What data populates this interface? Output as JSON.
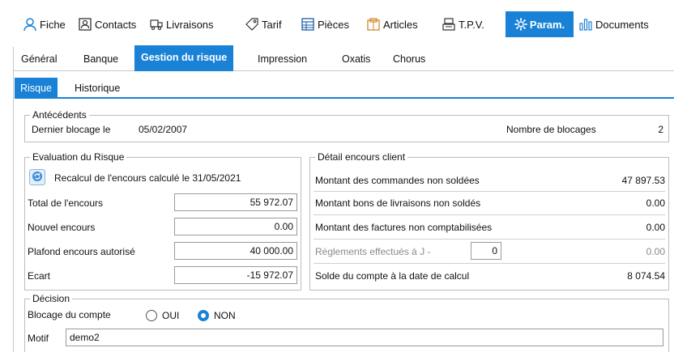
{
  "top_tabs": [
    {
      "label": "Fiche",
      "icon": "person-icon"
    },
    {
      "label": "Contacts",
      "icon": "contacts-icon"
    },
    {
      "label": "Livraisons",
      "icon": "delivery-icon"
    },
    {
      "label": "Tarif",
      "icon": "price-tag-icon"
    },
    {
      "label": "Pièces",
      "icon": "documents-grid-icon"
    },
    {
      "label": "Articles",
      "icon": "articles-icon"
    },
    {
      "label": "T.P.V.",
      "icon": "cash-register-icon"
    },
    {
      "label": "Param.",
      "icon": "gear-icon",
      "active": true
    },
    {
      "label": "Documents",
      "icon": "bar-chart-icon"
    }
  ],
  "sub_tabs": [
    "Général",
    "Banque",
    "Gestion du risque",
    "Impression",
    "Oxatis",
    "Chorus"
  ],
  "sub_tab_active": "Gestion du risque",
  "inner_tabs": [
    "Risque",
    "Historique"
  ],
  "inner_tab_active": "Risque",
  "antecedents": {
    "title": "Antécédents",
    "last_block_label": "Dernier blocage le",
    "last_block_date": "05/02/2007",
    "block_count_label": "Nombre de blocages",
    "block_count": "2"
  },
  "evaluation": {
    "title": "Evaluation du Risque",
    "recalc_label": "Recalcul de l'encours calculé le 31/05/2021",
    "total_label": "Total de l'encours",
    "total_value": "55 972.07",
    "new_label": "Nouvel encours",
    "new_value": "0.00",
    "ceiling_label": "Plafond encours autorisé",
    "ceiling_value": "40 000.00",
    "gap_label": "Ecart",
    "gap_value": "-15 972.07"
  },
  "detail": {
    "title": "Détail encours client",
    "orders_label": "Montant des commandes non soldées",
    "orders_value": "47 897.53",
    "delivery_label": "Montant bons de livraisons non soldés",
    "delivery_value": "0.00",
    "invoices_label": "Montant des factures non comptabilisées",
    "invoices_value": "0.00",
    "payments_label": "Règlements effectués à J -",
    "payments_days": "0",
    "payments_value": "0.00",
    "balance_label": "Solde du compte à  la date de calcul",
    "balance_value": "8 074.54"
  },
  "decision": {
    "title": "Décision",
    "block_label": "Blocage du compte",
    "opt_yes": "OUI",
    "opt_no": "NON",
    "selected": "NON",
    "reason_label": "Motif",
    "reason_value": "demo2"
  },
  "colors": {
    "accent": "#1a82d6"
  }
}
